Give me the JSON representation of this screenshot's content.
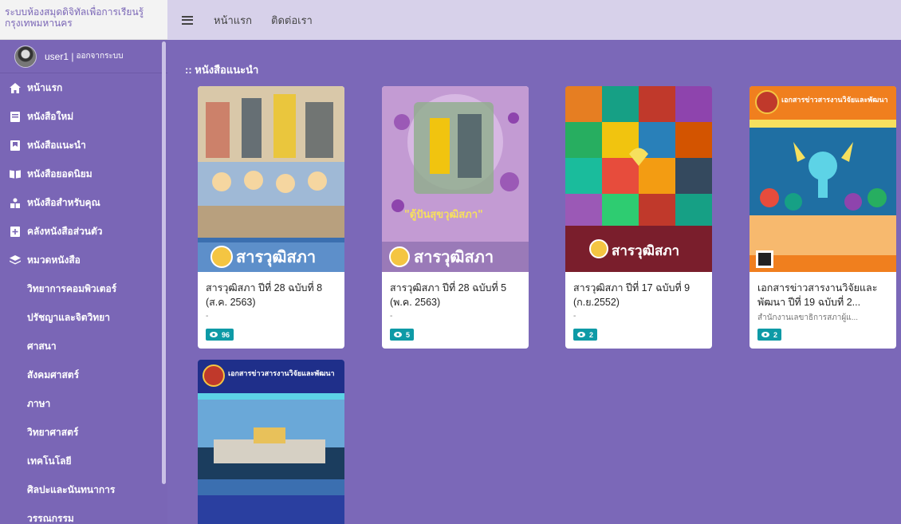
{
  "brand": {
    "line1": "ระบบห้องสมุดดิจิทัลเพื่อการเรียนรู้",
    "line2": "กรุงเทพมหานคร"
  },
  "user": {
    "name": "user1 |",
    "logout": "ออกจากระบบ"
  },
  "sidebar": {
    "items": [
      {
        "label": "หน้าแรก",
        "icon": "home-icon"
      },
      {
        "label": "หนังสือใหม่",
        "icon": "book-icon"
      },
      {
        "label": "หนังสือแนะนำ",
        "icon": "bookmark-book-icon"
      },
      {
        "label": "หนังสือยอดนิยม",
        "icon": "open-book-icon"
      },
      {
        "label": "หนังสือสำหรับคุณ",
        "icon": "user-book-icon"
      },
      {
        "label": "คลังหนังสือส่วนตัว",
        "icon": "plus-book-icon"
      },
      {
        "label": "หมวดหนังสือ",
        "icon": "layers-icon"
      }
    ],
    "categories": [
      "วิทยาการคอมพิวเตอร์",
      "ปรัชญาและจิตวิทยา",
      "ศาสนา",
      "สังคมศาสตร์",
      "ภาษา",
      "วิทยาศาสตร์",
      "เทคโนโลยี",
      "ศิลปะและนันทนาการ",
      "วรรณกรรม"
    ]
  },
  "topbar": {
    "home": "หน้าแรก",
    "contact": "ติดต่อเรา"
  },
  "main": {
    "section_title": ":: หนังสือแนะนำ",
    "books": [
      {
        "title": "สารวุฒิสภา ปีที่ 28 ฉบับที่ 8 (ส.ค. 2563)",
        "subtitle": "-",
        "views": "96",
        "cover_text": "สารวุฒิสภา",
        "cover_color": "#5d8fca"
      },
      {
        "title": "สารวุฒิสภา ปีที่ 28 ฉบับที่ 5 (พ.ค. 2563)",
        "subtitle": "-",
        "views": "5",
        "cover_text": "สารวุฒิสภา",
        "cover_banner": "\"ตู้ปันสุขวุฒิสภา\"",
        "cover_color": "#c39bd3"
      },
      {
        "title": "สารวุฒิสภา ปีที่ 17 ฉบับที่ 9 (ก.ย.2552)",
        "subtitle": "-",
        "views": "2",
        "cover_text": "สารวุฒิสภา",
        "cover_color": "#7a1e2c"
      },
      {
        "title": "เอกสารข่าวสารงานวิจัยและพัฒนา ปีที่ 19 ฉบับที่ 2...",
        "subtitle": "สำนักงานเลขาธิการสภาผู้แ...",
        "views": "2",
        "cover_text": "เอกสารข่าวสารงานวิจัยและพัฒนา",
        "cover_color": "#f07f1e"
      },
      {
        "title": "",
        "subtitle": "",
        "views": "",
        "cover_text": "เอกสารข่าวสารงานวิจัยและพัฒนา",
        "cover_color": "#2a3fa0"
      }
    ]
  }
}
